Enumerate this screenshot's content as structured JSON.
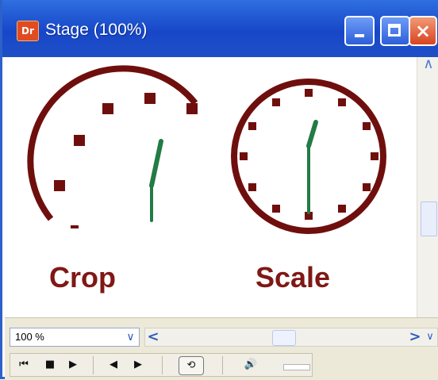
{
  "window": {
    "title": "Stage (100%)",
    "icon": "app-icon",
    "icon_text": "Dr",
    "controls": [
      "minimize-icon",
      "maximize-icon",
      "close-icon"
    ]
  },
  "stage": {
    "labels": {
      "crop": "Crop",
      "scale": "Scale"
    },
    "colors": {
      "clock": "#6f0f0d",
      "hand": "#237b45"
    }
  },
  "footer": {
    "zoom_value": "100 %",
    "scroll_arrows": {
      "left": "<",
      "right": ">",
      "down": "∨",
      "up": "∧"
    },
    "playback_buttons": [
      "rewind-icon",
      "stop-icon",
      "play-icon",
      "step-back-icon",
      "step-forward-icon",
      "loop-icon",
      "volume-icon"
    ]
  }
}
